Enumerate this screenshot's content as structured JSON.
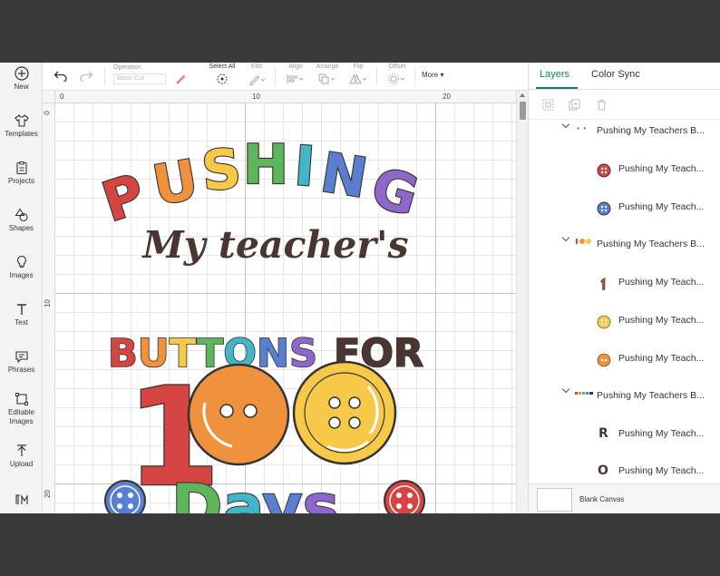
{
  "sidebar": {
    "items": [
      {
        "label": "New",
        "icon": "plus-circle-icon"
      },
      {
        "label": "Templates",
        "icon": "shirt-icon"
      },
      {
        "label": "Projects",
        "icon": "clipboard-icon"
      },
      {
        "label": "Shapes",
        "icon": "shapes-icon"
      },
      {
        "label": "Images",
        "icon": "lightbulb-icon"
      },
      {
        "label": "Text",
        "icon": "text-t-icon"
      },
      {
        "label": "Phrases",
        "icon": "speech-bubble-icon"
      },
      {
        "label": "Editable",
        "label2": "Images",
        "icon": "editable-images-icon"
      },
      {
        "label": "Upload",
        "icon": "upload-arrow-icon"
      },
      {
        "label": "",
        "icon": "monogram-icon"
      }
    ]
  },
  "toolbar": {
    "operation_label": "Operation",
    "operation_value": "Basic Cut",
    "select_all_label": "Select All",
    "edit_label": "Edit",
    "align_label": "Align",
    "arrange_label": "Arrange",
    "flip_label": "Flip",
    "offset_label": "Offset",
    "more_label": "More"
  },
  "ruler": {
    "top": [
      "0",
      "10",
      "20"
    ],
    "left": [
      "0",
      "10",
      "20"
    ]
  },
  "design": {
    "line1": "PUSHING",
    "line2": "My teacher's",
    "line3a": "BUTTONS",
    "line3b": "FOR",
    "line4": "1",
    "line5": "Days",
    "colors": {
      "red": "#d64541",
      "orange": "#f0913d",
      "yellow": "#f7c948",
      "green": "#5fb55a",
      "teal": "#43b5c9",
      "blue": "#5a7fd1",
      "purple": "#8f66c9",
      "brown": "#4a3630",
      "outline": "#333333"
    }
  },
  "panel": {
    "tabs": [
      "Layers",
      "Color Sync"
    ],
    "layers": [
      {
        "name": "Pushing My Teachers B...",
        "type": "group"
      },
      {
        "name": "Pushing My Teach...",
        "type": "item",
        "thumb": "red-button-icon"
      },
      {
        "name": "Pushing My Teach...",
        "type": "item",
        "thumb": "purple-button-icon"
      },
      {
        "name": "Pushing My Teachers B...",
        "type": "group",
        "thumb": "100-thumbnail-icon"
      },
      {
        "name": "Pushing My Teach...",
        "type": "item",
        "thumb": "number-1-icon"
      },
      {
        "name": "Pushing My Teach...",
        "type": "item",
        "thumb": "yellow-button-icon"
      },
      {
        "name": "Pushing My Teach...",
        "type": "item",
        "thumb": "orange-button-icon"
      },
      {
        "name": "Pushing My Teachers B...",
        "type": "group",
        "thumb": "text-thumbnail-icon"
      },
      {
        "name": "Pushing My Teach...",
        "type": "item",
        "thumb": "letter-r-icon",
        "glyph": "R"
      },
      {
        "name": "Pushing My Teach...",
        "type": "item",
        "thumb": "letter-o-icon",
        "glyph": "O"
      }
    ],
    "blank_canvas": "Blank Canvas"
  }
}
